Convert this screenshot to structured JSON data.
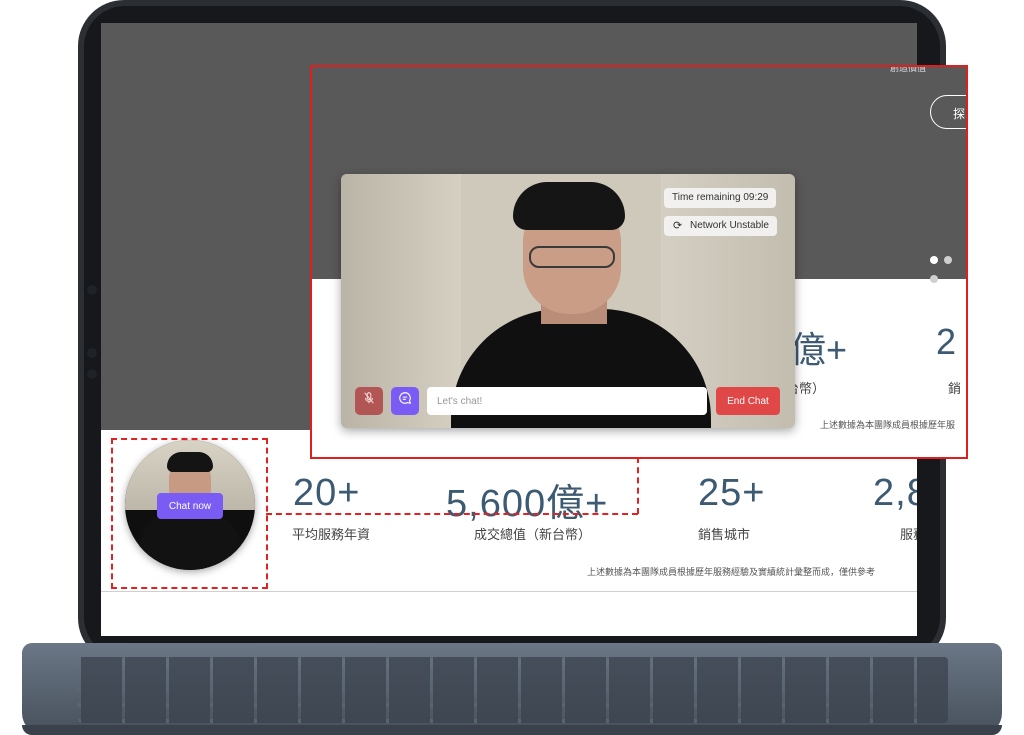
{
  "stats": [
    {
      "value": "20+",
      "label": "平均服務年資"
    },
    {
      "value": "5,600億+",
      "label": "成交總值（新台幣）"
    },
    {
      "value": "25+",
      "label": "銷售城市"
    },
    {
      "value": "2,8",
      "label": "服務"
    }
  ],
  "stats_note": "上述數據為本團隊成員根據歷年服務經驗及實績統計彙整而成，僅供參考",
  "chat_now_label": "Chat now",
  "zoom": {
    "top_text": "創造價值",
    "explore_label": "探",
    "stat_value_1": "億+",
    "stat_label_1": "台幣）",
    "stat_value_2": "2",
    "stat_label_2": "銷",
    "note": "上述數據為本團隊成員根據歷年服"
  },
  "video_chat": {
    "time_remaining": "Time remaining 09:29",
    "network_status": "Network Unstable",
    "input_placeholder": "Let's chat!",
    "end_chat_label": "End Chat"
  },
  "colors": {
    "accent": "#7a5cf5",
    "danger": "#e04848",
    "highlight": "#e01e1e",
    "stat_text": "#3d5a73"
  }
}
